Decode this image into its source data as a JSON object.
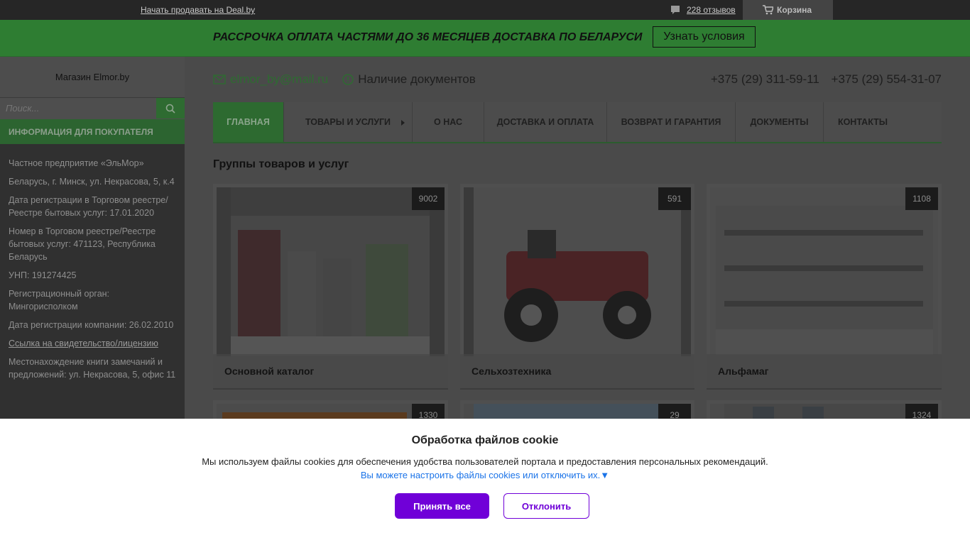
{
  "topbar": {
    "sell_link": "Начать продавать на Deal.by",
    "reviews": "228 отзывов",
    "cart": "Корзина"
  },
  "promo": {
    "text": "РАССРОЧКА ОПЛАТА ЧАСТЯМИ ДО 36 МЕСЯЦЕВ ДОСТАВКА ПО БЕЛАРУСИ",
    "button": "Узнать условия"
  },
  "sidebar": {
    "shop_name": "Магазин Elmor.by",
    "search_placeholder": "Поиск...",
    "info_header": "ИНФОРМАЦИЯ ДЛЯ ПОКУПАТЕЛЯ",
    "info": [
      "Частное предприятие «ЭльМор»",
      "Беларусь, г. Минск, ул. Некрасова, 5, к.4",
      "Дата регистрации в Торговом реестре/Реестре бытовых услуг: 17.01.2020",
      "Номер в Торговом реестре/Реестре бытовых услуг: 471123, Республика Беларусь",
      "УНП: 191274425",
      "Регистрационный орган: Мингорисполком",
      "Дата регистрации компании: 26.02.2010",
      "Ссылка на свидетельство/лицензию",
      "Местонахождение книги замечаний и предложений: ул. Некрасова, 5, офис 11"
    ]
  },
  "header": {
    "email": "elmor_by@mail.ru",
    "docs": "Наличие документов",
    "phone1": "+375 (29) 311-59-11",
    "phone2": "+375 (29) 554-31-07"
  },
  "nav": [
    "ГЛАВНАЯ",
    "ТОВАРЫ И УСЛУГИ",
    "О НАС",
    "ДОСТАВКА И ОПЛАТА",
    "ВОЗВРАТ И ГАРАНТИЯ",
    "ДОКУМЕНТЫ",
    "КОНТАКТЫ"
  ],
  "section_title": "Группы товаров и услуг",
  "groups": [
    {
      "name": "Основной каталог",
      "count": "9002"
    },
    {
      "name": "Сельхозтехника",
      "count": "591"
    },
    {
      "name": "Альфамаг",
      "count": "1108"
    },
    {
      "name": "",
      "count": "1330"
    },
    {
      "name": "",
      "count": "29"
    },
    {
      "name": "",
      "count": "1324"
    }
  ],
  "cookie": {
    "title": "Обработка файлов cookie",
    "description": "Мы используем файлы cookies для обеспечения удобства пользователей портала и предоставления персональных рекомендаций.",
    "settings_link": "Вы можете настроить файлы cookies или отключить их.▼",
    "accept": "Принять все",
    "decline": "Отклонить"
  },
  "colors": {
    "accent_green": "#2e7d32",
    "cookie_purple": "#7000d8"
  }
}
